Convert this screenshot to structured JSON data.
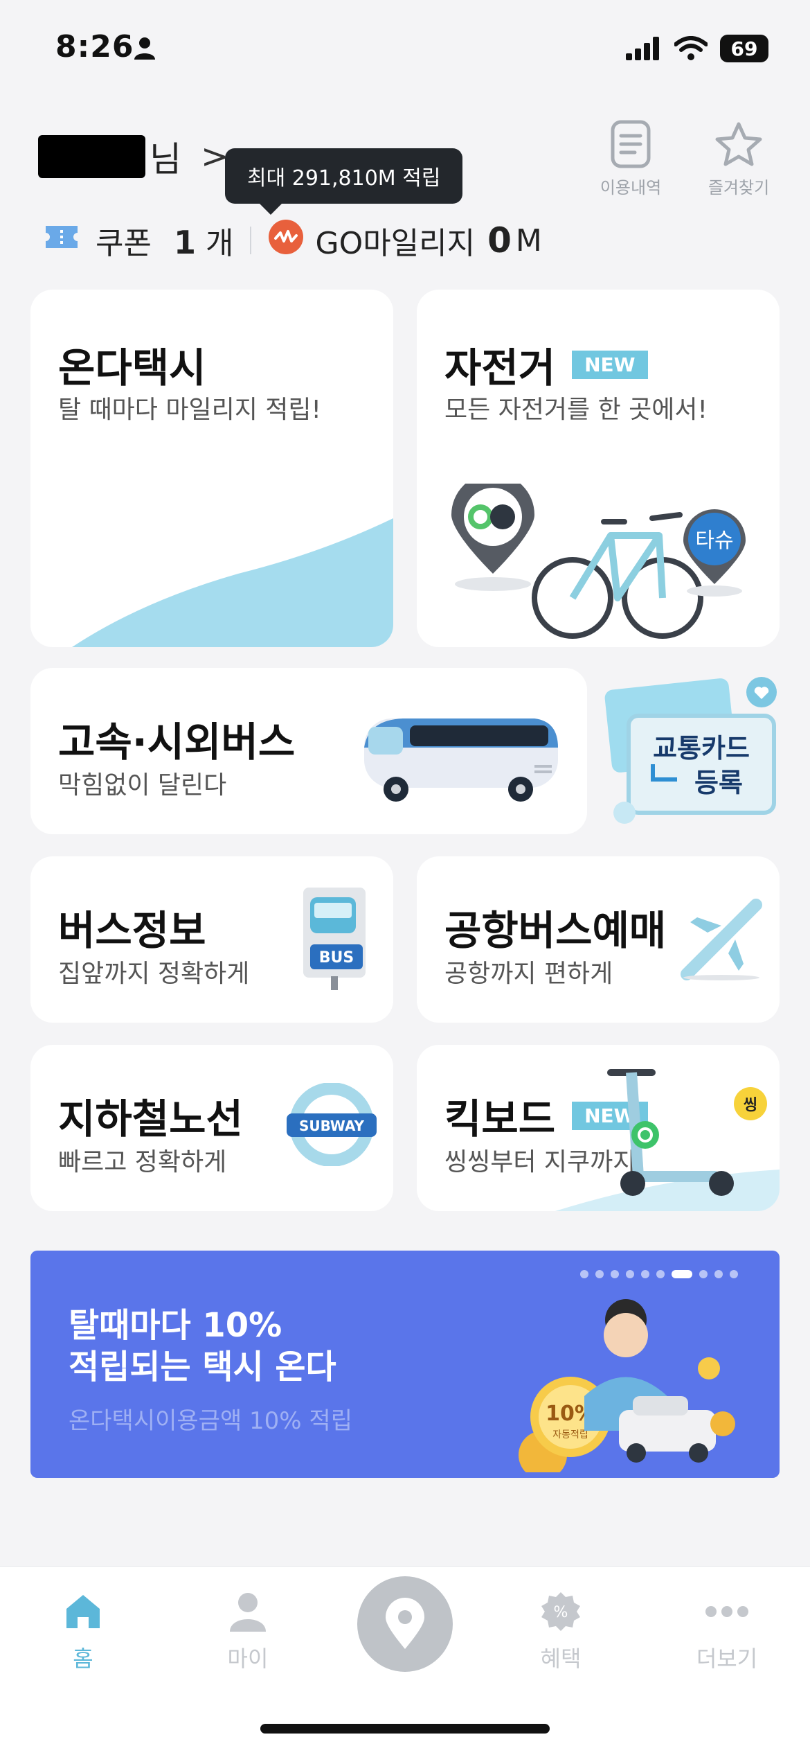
{
  "status_bar": {
    "time": "8:26",
    "battery": "69"
  },
  "header": {
    "user_suffix": "님",
    "chevron": ">",
    "history_label": "이용내역",
    "favorites_label": "즐겨찾기",
    "tooltip": "최대 291,810M 적립",
    "coupon_label": "쿠폰",
    "coupon_count": "1",
    "coupon_unit": "개",
    "mileage_label": "GO마일리지",
    "mileage_value": "0",
    "mileage_unit": "M"
  },
  "cards": {
    "taxi": {
      "title": "온다택시",
      "subtitle": "탈 때마다 마일리지 적립!"
    },
    "bike": {
      "title": "자전거",
      "badge": "NEW",
      "subtitle": "모든 자전거를 한 곳에서!",
      "pin_text": "타슈"
    },
    "express_bus": {
      "title": "고속·시외버스",
      "subtitle": "막힘없이 달린다"
    },
    "transit_card": {
      "label_line1": "교통카드",
      "label_line2": "등록"
    },
    "bus_info": {
      "title": "버스정보",
      "subtitle": "집앞까지 정확하게",
      "icon_text": "BUS"
    },
    "airport_bus": {
      "title": "공항버스예매",
      "subtitle": "공항까지 편하게"
    },
    "subway": {
      "title": "지하철노선",
      "subtitle": "빠르고 정확하게",
      "icon_text": "SUBWAY"
    },
    "kickboard": {
      "title": "킥보드",
      "badge": "NEW",
      "subtitle": "씽씽부터 지쿠까지",
      "sticker_text": "씽"
    }
  },
  "banner": {
    "title": "탈때마다 10%\n적립되는 택시 온다",
    "subtitle": "온다택시이용금액 10% 적립",
    "coin_text": "10%",
    "coin_sub": "자동적립",
    "page_count": 10,
    "active_index": 6
  },
  "tabbar": {
    "home": "홈",
    "my": "마이",
    "benefits": "혜택",
    "more": "더보기"
  },
  "colors": {
    "accent": "#5cb7d9",
    "banner": "#5a75ea",
    "badge": "#71c7e0",
    "mileage_icon": "#e8603c"
  }
}
